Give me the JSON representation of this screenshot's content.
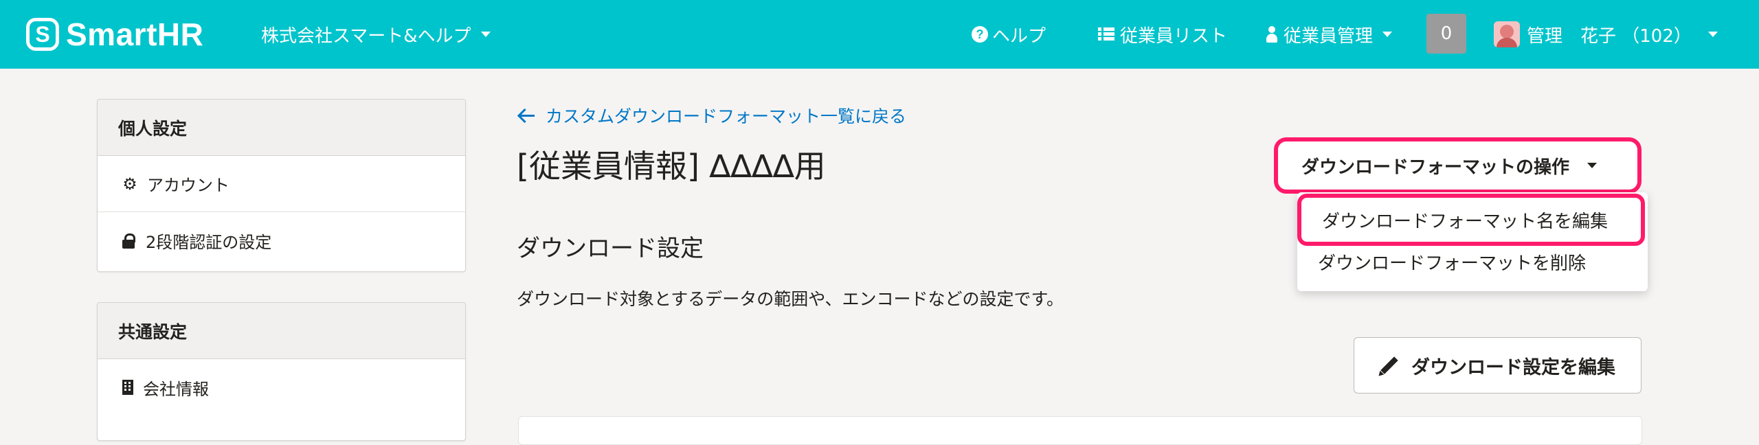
{
  "header": {
    "logo_mark": "S",
    "logo_text": "SmartHR",
    "company": "株式会社スマート&ヘルプ",
    "nav": {
      "help": "ヘルプ",
      "employee_list": "従業員リスト",
      "employee_management": "従業員管理"
    },
    "notification_count": "0",
    "user_name": "管理　花子 （102）"
  },
  "sidebar": {
    "personal": {
      "heading": "個人設定",
      "items": [
        {
          "label": "アカウント",
          "icon": "gear-icon"
        },
        {
          "label": "2段階認証の設定",
          "icon": "lock-icon"
        }
      ]
    },
    "shared": {
      "heading": "共通設定",
      "items": [
        {
          "label": "会社情報",
          "icon": "building-icon"
        }
      ]
    }
  },
  "main": {
    "back_link": "カスタムダウンロードフォーマット一覧に戻る",
    "title": "[従業員情報] ∆∆∆∆用",
    "section_title": "ダウンロード設定",
    "section_desc": "ダウンロード対象とするデータの範囲や、エンコードなどの設定です。",
    "ops_button": "ダウンロードフォーマットの操作",
    "dropdown": {
      "items": [
        "ダウンロードフォーマット名を編集",
        "ダウンロードフォーマットを削除"
      ]
    },
    "edit_button": "ダウンロード設定を編集"
  },
  "colors": {
    "header_bg": "#00c4cc",
    "link": "#0077c7",
    "highlight": "#ff1a6a",
    "badge_bg": "#9b9b9b"
  }
}
